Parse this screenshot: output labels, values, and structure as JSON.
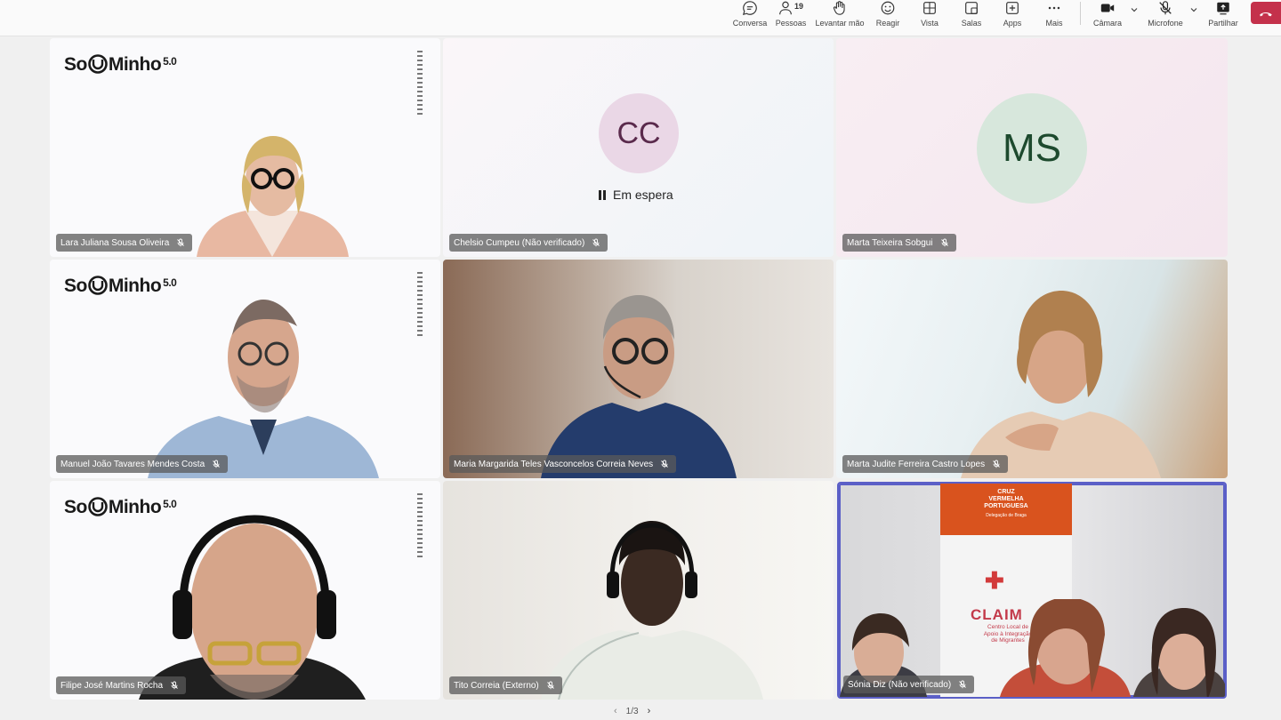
{
  "toolbar": {
    "chat": "Conversa",
    "people": "Pessoas",
    "people_count": "19",
    "raise_hand": "Levantar mão",
    "react": "Reagir",
    "view": "Vista",
    "rooms": "Salas",
    "apps": "Apps",
    "more": "Mais",
    "camera": "Câmara",
    "microphone": "Microfone",
    "share": "Partilhar"
  },
  "logo": {
    "text": "So",
    "text2": "Minho",
    "version": "5.0"
  },
  "tiles": [
    {
      "name": "Lara Juliana Sousa Oliveira"
    },
    {
      "name": "Chelsio Cumpeu (Não verificado)",
      "initials": "CC",
      "status": "Em espera"
    },
    {
      "name": "Marta Teixeira Sobgui",
      "initials": "MS"
    },
    {
      "name": "Manuel João Tavares Mendes Costa"
    },
    {
      "name": "Maria Margarida Teles Vasconcelos Correia Neves"
    },
    {
      "name": "Marta Judite Ferreira Castro Lopes"
    },
    {
      "name": "Filipe José Martins Rocha"
    },
    {
      "name": "Tito Correia (Externo)"
    },
    {
      "name": "Sónia Diz (Não verificado)"
    }
  ],
  "banner": {
    "org_line1": "CRUZ",
    "org_line2": "VERMELHA",
    "org_line3": "PORTUGUESA",
    "org_sub": "Delegação de Braga",
    "claim": "CLAIM",
    "claim_sub1": "Centro Local de",
    "claim_sub2": "Apoio à Integração",
    "claim_sub3": "de Migrantes"
  },
  "pager": {
    "label": "1/3"
  },
  "colors": {
    "accent": "#5b5fc7",
    "leave": "#c4314b",
    "cc_bg": "#ead7e6",
    "ms_bg": "#d7e7dc"
  }
}
